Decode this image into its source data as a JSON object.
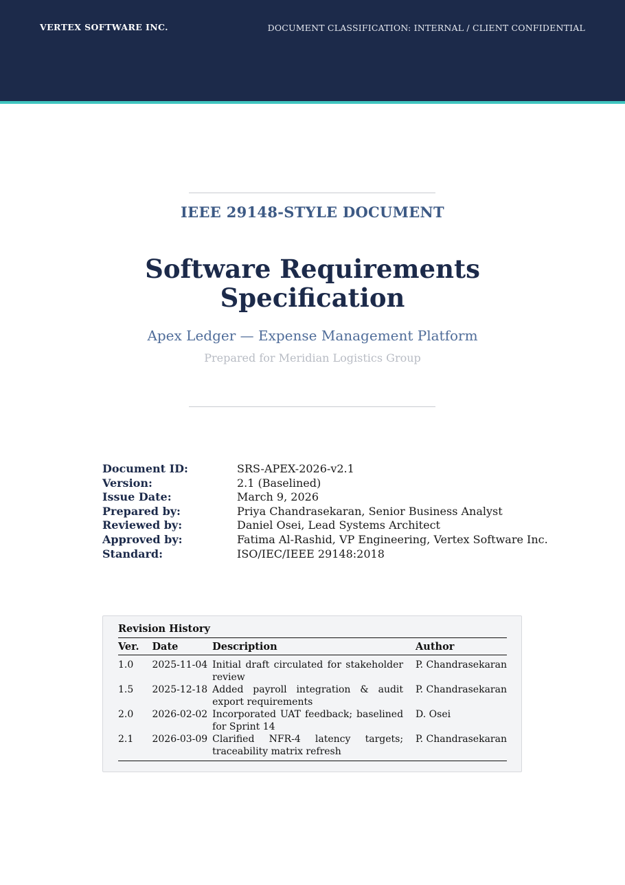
{
  "header": {
    "company": "VERTEX SOFTWARE INC.",
    "classification": "DOCUMENT CLASSIFICATION: INTERNAL / CLIENT CONFIDENTIAL"
  },
  "cover": {
    "doc_type": "IEEE 29148-STYLE DOCUMENT",
    "title_line1": "Software Requirements",
    "title_line2": "Specification",
    "subtitle": "Apex Ledger — Expense Management Platform",
    "prepared_for": "Prepared for Meridian Logistics Group"
  },
  "metadata": [
    {
      "label": "Document ID:",
      "value": "SRS-APEX-2026-v2.1"
    },
    {
      "label": "Version:",
      "value": "2.1 (Baselined)"
    },
    {
      "label": "Issue Date:",
      "value": "March 9, 2026"
    },
    {
      "label": "Prepared by:",
      "value": "Priya Chandrasekaran, Senior Business Analyst"
    },
    {
      "label": "Reviewed by:",
      "value": "Daniel Osei, Lead Systems Architect"
    },
    {
      "label": "Approved by:",
      "value": "Fatima Al-Rashid, VP Engineering, Vertex Software Inc."
    },
    {
      "label": "Standard:",
      "value": "ISO/IEC/IEEE 29148:2018"
    }
  ],
  "revision_history": {
    "caption": "Revision History",
    "columns": [
      "Ver.",
      "Date",
      "Description",
      "Author"
    ],
    "rows": [
      [
        "1.0",
        "2025-11-04",
        "Initial draft circulated for stakeholder re­view",
        "P. Chandrasekaran"
      ],
      [
        "1.5",
        "2025-12-18",
        "Added payroll integration & audit export requirements",
        "P. Chandrasekaran"
      ],
      [
        "2.0",
        "2026-02-02",
        "Incorporated UAT feedback; baselined for Sprint 14",
        "D. Osei"
      ],
      [
        "2.1",
        "2026-03-09",
        "Clarified NFR-4 latency targets; traceabil­ity matrix refresh",
        "P. Chandrasekaran"
      ]
    ]
  },
  "colors": {
    "header_band": "#1c2a4a",
    "accent_stripe": "#3fc5c0",
    "heading_blue": "#3d5a85"
  }
}
